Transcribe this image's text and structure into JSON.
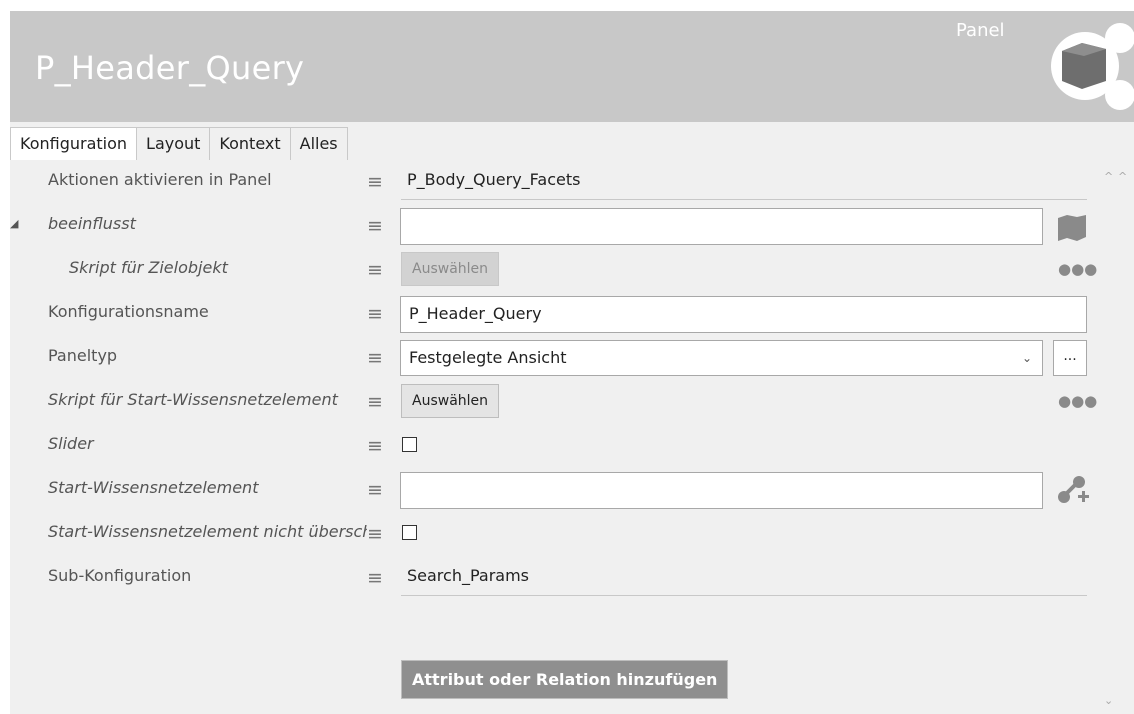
{
  "header": {
    "title": "P_Header_Query",
    "type_label": "Panel",
    "type_icon": "panel-network-icon"
  },
  "tabs": [
    {
      "label": "Konfiguration",
      "active": true
    },
    {
      "label": "Layout"
    },
    {
      "label": "Kontext"
    },
    {
      "label": "Alles"
    }
  ],
  "rows": {
    "aktionen": {
      "label": "Aktionen aktivieren in Panel",
      "value": "P_Body_Query_Facets"
    },
    "beeinflusst": {
      "label": "beeinflusst",
      "value": "",
      "icon": "shape-icon"
    },
    "skript_ziel": {
      "label": "Skript für Zielobjekt",
      "button": "Auswählen",
      "more": "●●●"
    },
    "konfigname": {
      "label": "Konfigurationsname",
      "value": "P_Header_Query"
    },
    "paneltyp": {
      "label": "Paneltyp",
      "value": "Festgelegte Ansicht",
      "chevron": "⌄",
      "ellipsis": "..."
    },
    "skript_start": {
      "label": "Skript für Start-Wissensnetzelement",
      "button": "Auswählen",
      "more": "●●●"
    },
    "slider": {
      "label": "Slider",
      "checked": false
    },
    "start_wne": {
      "label": "Start-Wissensnetzelement",
      "value": "",
      "icon": "add-relation-icon"
    },
    "start_nicht": {
      "label": "Start-Wissensnetzelement nicht überschreiben",
      "checked": false
    },
    "subkonfig": {
      "label": "Sub-Konfiguration",
      "value": "Search_Params"
    }
  },
  "add_button": "Attribut oder Relation hinzufügen",
  "menu_glyph": "≡",
  "expander_glyph": "◢",
  "scroll": {
    "up": "^",
    "down": "⌄"
  },
  "colors": {
    "header_bg": "#c8c8c8",
    "panel_bg": "#f0f0f0",
    "icon_gray": "#8a8a8a",
    "primary_button": "#8f8f8f"
  }
}
